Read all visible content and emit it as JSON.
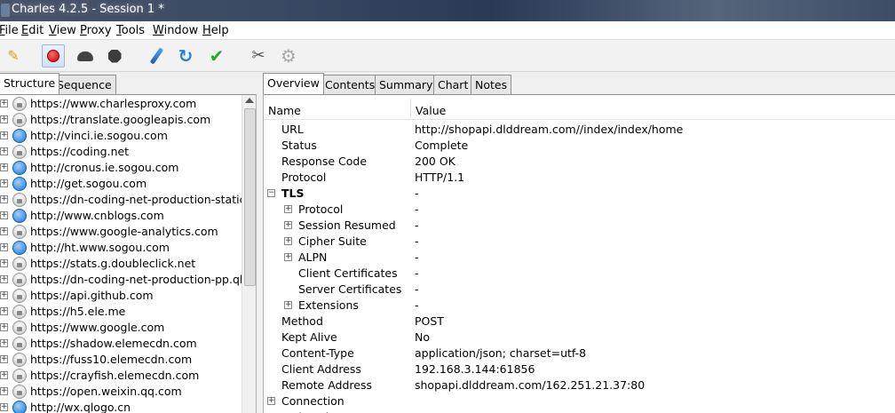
{
  "window": {
    "title": "Charles 4.2.5 - Session 1 *"
  },
  "menu": [
    {
      "label": "File",
      "ul": "F",
      "rest": "ile"
    },
    {
      "label": "Edit",
      "ul": "E",
      "rest": "dit"
    },
    {
      "label": "View",
      "ul": "V",
      "rest": "iew"
    },
    {
      "label": "Proxy",
      "ul": "P",
      "rest": "roxy"
    },
    {
      "label": "Tools",
      "ul": "T",
      "rest": "ools"
    },
    {
      "label": "Window",
      "ul": "W",
      "rest": "indow"
    },
    {
      "label": "Help",
      "ul": "H",
      "rest": "elp"
    }
  ],
  "toolbar": {
    "icons": [
      "broom-icon",
      "record-icon",
      "turtle-icon",
      "stop-icon",
      "pen-icon",
      "refresh-icon",
      "check-icon",
      "tools-icon",
      "gear-icon"
    ],
    "glyphs": {
      "refresh": "↻",
      "check": "✔",
      "tools": "✂",
      "gear": "⚙",
      "broom": "✎"
    }
  },
  "left_tabs": [
    "Structure",
    "Sequence"
  ],
  "hosts": [
    {
      "label": "https://www.charlesproxy.com",
      "secure": true
    },
    {
      "label": "https://translate.googleapis.com",
      "secure": true
    },
    {
      "label": "http://vinci.ie.sogou.com",
      "secure": false
    },
    {
      "label": "https://coding.net",
      "secure": true
    },
    {
      "label": "http://cronus.ie.sogou.com",
      "secure": false
    },
    {
      "label": "http://get.sogou.com",
      "secure": false
    },
    {
      "label": "https://dn-coding-net-production-static.c",
      "secure": true
    },
    {
      "label": "http://www.cnblogs.com",
      "secure": false
    },
    {
      "label": "https://www.google-analytics.com",
      "secure": true
    },
    {
      "label": "http://ht.www.sogou.com",
      "secure": false
    },
    {
      "label": "https://stats.g.doubleclick.net",
      "secure": true
    },
    {
      "label": "https://dn-coding-net-production-pp.qbo",
      "secure": true
    },
    {
      "label": "https://api.github.com",
      "secure": true
    },
    {
      "label": "https://h5.ele.me",
      "secure": true
    },
    {
      "label": "https://www.google.com",
      "secure": true
    },
    {
      "label": "https://shadow.elemecdn.com",
      "secure": true
    },
    {
      "label": "https://fuss10.elemecdn.com",
      "secure": true
    },
    {
      "label": "https://crayfish.elemecdn.com",
      "secure": true
    },
    {
      "label": "https://open.weixin.qq.com",
      "secure": true
    },
    {
      "label": "http://wx.qlogo.cn",
      "secure": false
    }
  ],
  "right_tabs": [
    "Overview",
    "Contents",
    "Summary",
    "Chart",
    "Notes"
  ],
  "columns": {
    "name": "Name",
    "value": "Value"
  },
  "properties": [
    {
      "name": "URL",
      "value": "http://shopapi.dlddream.com//index/index/home",
      "level": 0,
      "expander": ""
    },
    {
      "name": "Status",
      "value": "Complete",
      "level": 0,
      "expander": ""
    },
    {
      "name": "Response Code",
      "value": "200 OK",
      "level": 0,
      "expander": ""
    },
    {
      "name": "Protocol",
      "value": "HTTP/1.1",
      "level": 0,
      "expander": ""
    },
    {
      "name": "TLS",
      "value": "-",
      "level": 0,
      "expander": "−",
      "bold": true
    },
    {
      "name": "Protocol",
      "value": "-",
      "level": 1,
      "expander": "+"
    },
    {
      "name": "Session Resumed",
      "value": "-",
      "level": 1,
      "expander": "+"
    },
    {
      "name": "Cipher Suite",
      "value": "-",
      "level": 1,
      "expander": "+"
    },
    {
      "name": "ALPN",
      "value": "-",
      "level": 1,
      "expander": "+"
    },
    {
      "name": "Client Certificates",
      "value": "-",
      "level": 1,
      "expander": ""
    },
    {
      "name": "Server Certificates",
      "value": "-",
      "level": 1,
      "expander": ""
    },
    {
      "name": "Extensions",
      "value": "-",
      "level": 1,
      "expander": "+"
    },
    {
      "name": "Method",
      "value": "POST",
      "level": 0,
      "expander": ""
    },
    {
      "name": "Kept Alive",
      "value": "No",
      "level": 0,
      "expander": ""
    },
    {
      "name": "Content-Type",
      "value": "application/json; charset=utf-8",
      "level": 0,
      "expander": ""
    },
    {
      "name": "Client Address",
      "value": "192.168.3.144:61856",
      "level": 0,
      "expander": ""
    },
    {
      "name": "Remote Address",
      "value": "shopapi.dlddream.com/162.251.21.37:80",
      "level": 0,
      "expander": ""
    },
    {
      "name": "Connection",
      "value": "",
      "level": 0,
      "expander": "+"
    },
    {
      "name": "WebSockets",
      "value": "",
      "level": 0,
      "expander": "+"
    }
  ]
}
